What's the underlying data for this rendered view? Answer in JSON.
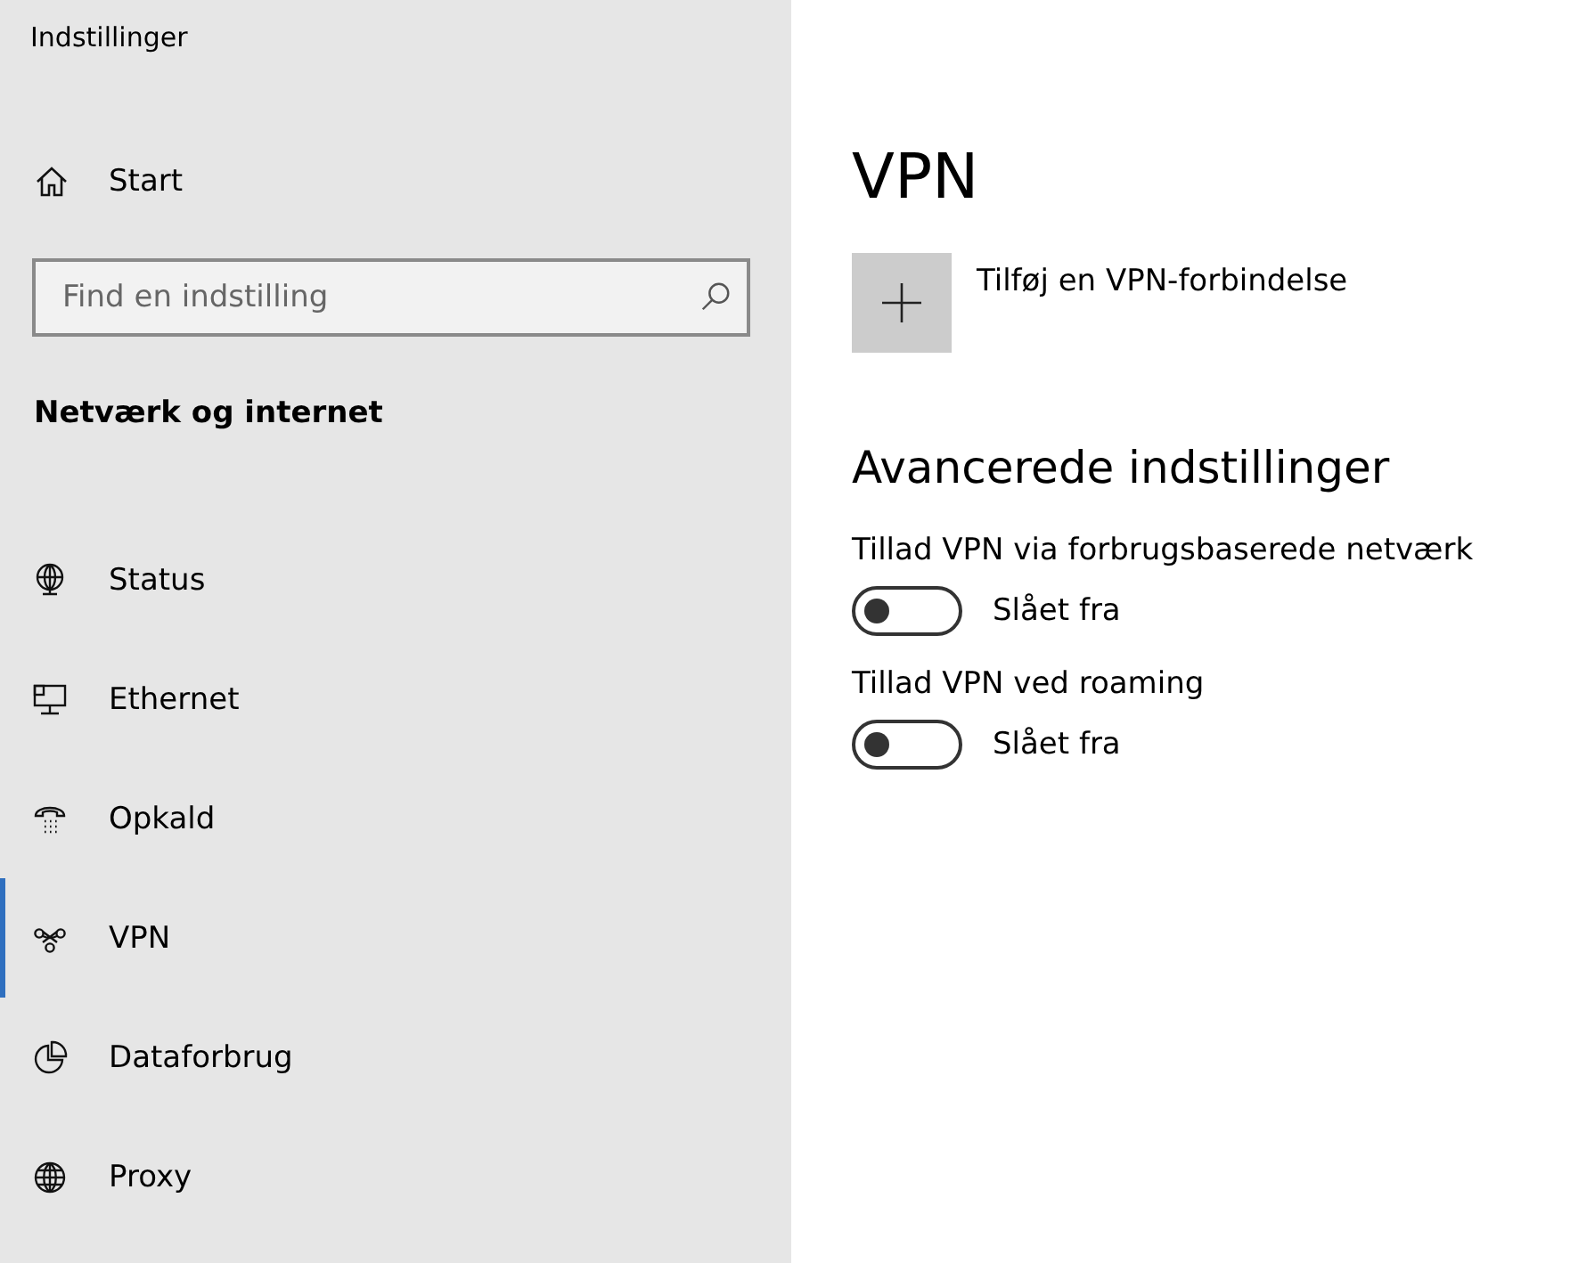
{
  "window": {
    "title": "Indstillinger"
  },
  "sidebar": {
    "home": {
      "label": "Start"
    },
    "search": {
      "placeholder": "Find en indstilling"
    },
    "section": "Netværk og internet",
    "items": [
      {
        "label": "Status",
        "selected": false
      },
      {
        "label": "Ethernet",
        "selected": false
      },
      {
        "label": "Opkald",
        "selected": false
      },
      {
        "label": "VPN",
        "selected": true
      },
      {
        "label": "Dataforbrug",
        "selected": false
      },
      {
        "label": "Proxy",
        "selected": false
      }
    ]
  },
  "main": {
    "title": "VPN",
    "add": {
      "label": "Tilføj en VPN-forbindelse"
    },
    "advanced_heading": "Avancerede indstillinger",
    "settings": [
      {
        "label": "Tillad VPN via forbrugsbaserede netværk",
        "on": false,
        "state": "Slået fra"
      },
      {
        "label": "Tillad VPN ved roaming",
        "on": false,
        "state": "Slået fra"
      }
    ]
  }
}
